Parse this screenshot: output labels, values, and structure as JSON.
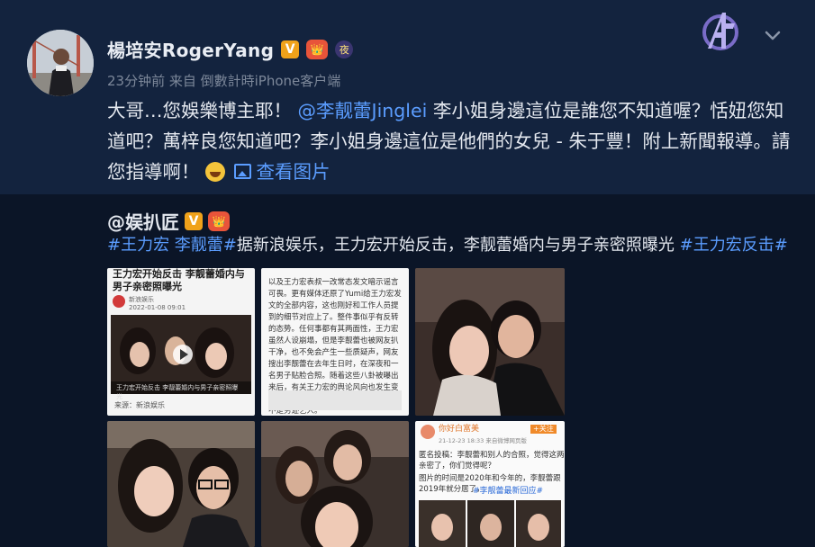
{
  "post": {
    "author": "楊培安RogerYang",
    "badges": {
      "verified": "V",
      "crown": "👑",
      "night": "夜"
    },
    "meta": "23分钟前 来自 倒數計時iPhone客户端",
    "text_before_mention": "大哥…您娛樂博主耶！",
    "mention": "@李靓蕾Jinglei",
    "text_after_mention": " 李小姐身邊這位是誰您不知道喔？恬妞您知道吧？萬梓良您知道吧？李小姐身邊這位是他們的女兒 - 朱于豐！附上新聞報導。請您指導啊！",
    "view_images_label": "查看图片",
    "icons": [
      "avengers-logo-icon",
      "chevron-down-icon",
      "grin-emoji-icon",
      "image-icon"
    ]
  },
  "repost": {
    "author": "@娱扒匠",
    "tag1": "#王力宏 李靓蕾#",
    "text": "据新浪娱乐，王力宏开始反击，李靓蕾婚内与男子亲密照曝光 ",
    "tag2": "#王力宏反击#"
  },
  "thumbnails": {
    "t1": {
      "headline": "王力宏开始反击 李靓蕾婚内与男子亲密照曝光",
      "source_name": "新浪娱乐",
      "date": "2022-01-08 09:01",
      "caption": "王力宏开始反击 李靓蕾婚内与男子亲密照曝光",
      "footer": "来源：新浪娱乐"
    },
    "t2": {
      "body": "以及王力宏表叔一改常态发文暗示谣言可畏。更有媒体还原了Yumi给王力宏发文的全部内容，这也刚好和工作人员提到的细节对应上了。整件事似乎有反转的态势。任何事都有其两面性，王力宏虽然人设崩塌，但是李靓蕾也被网友扒干净，也不免会产生一些质疑声，网友搜出李靓蕾在去年生日时，在深夜和一名男子贴脸合照。随着这些八卦被曝出来后，有关王力宏的舆论风向也发生变化。有网友替王力宏发声，直言他从来不是劣迹艺人。"
    },
    "t6": {
      "user": "你好白富美",
      "follow": "+关注",
      "date": "21-12-23 18:33  来自微博网页版",
      "line1": "匿名投稿：李靓蕾和别人的合照，觉得这两",
      "line2": "亲密了，你们觉得呢？",
      "line3": "图片的时间是2020年和今年的，李靓蕾跟",
      "line4": "2019年就分居了，",
      "tag": "#李靓蕾最新回应#"
    }
  },
  "colors": {
    "background": "#0f1a2c",
    "card": "#13233e",
    "repost_bg": "#0b1527",
    "link": "#5b9dff",
    "meta": "#7d889a"
  }
}
